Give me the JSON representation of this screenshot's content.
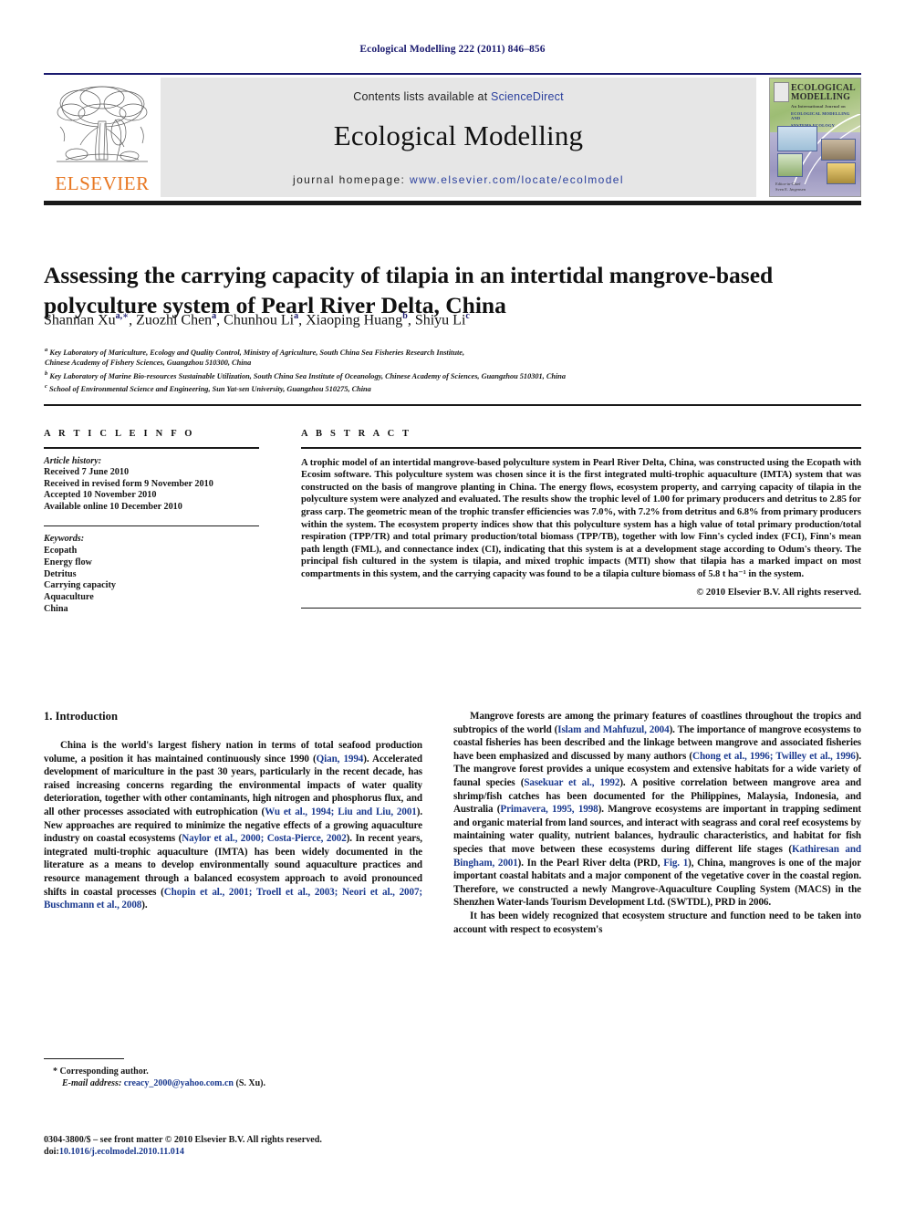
{
  "running_head": "Ecological Modelling 222 (2011) 846–856",
  "masthead": {
    "contents_prefix": "Contents lists available at ",
    "sciencedirect": "ScienceDirect",
    "journal_title": "Ecological Modelling",
    "homepage_label": "journal homepage: ",
    "homepage_url": "www.elsevier.com/locate/ecolmodel",
    "publisher_wordmark": "ELSEVIER",
    "publisher_logo_icon": "elsevier-tree-icon",
    "cover": {
      "line1": "ECOLOGICAL",
      "line2": "MODELLING",
      "subtitle": "An International Journal on",
      "scope": "ECOLOGICAL MODELLING AND",
      "scope2": "SYSTEMS ECOLOGY",
      "editor_label": "Editor-in-Chief",
      "editor": "Sven E. Jørgensen"
    },
    "accent_blue": "#1b1b6f",
    "banner_bg": "#e6e6e6",
    "link_blue": "#2a3f9d",
    "elsevier_orange": "#e87722"
  },
  "article": {
    "title": "Assessing the carrying capacity of tilapia in an intertidal mangrove-based polyculture system of Pearl River Delta, China",
    "authors_html": "Shannan Xu<sup>a,∗</sup>, Zuozhi Chen<sup>a</sup>, Chunhou Li<sup>a</sup>, Xiaoping Huang<sup>b</sup>, Shiyu Li<sup>c</sup>",
    "affiliations": [
      "<sup>a</sup> Key Laboratory of Mariculture, Ecology and Quality Control, Ministry of Agriculture, South China Sea Fisheries Research Institute,",
      "Chinese Academy of Fishery Sciences, Guangzhou 510300, China",
      "<sup>b</sup> Key Laboratory of Marine Bio-resources Sustainable Utilization, South China Sea Institute of Oceanology, Chinese Academy of Sciences, Guangzhou 510301, China",
      "<sup>c</sup> School of Environmental Science and Engineering, Sun Yat-sen University, Guangzhou 510275, China"
    ]
  },
  "article_info": {
    "heading": "A R T I C L E   I N F O",
    "history_label": "Article history:",
    "history": [
      "Received 7 June 2010",
      "Received in revised form 9 November 2010",
      "Accepted 10 November 2010",
      "Available online 10 December 2010"
    ],
    "keywords_label": "Keywords:",
    "keywords": [
      "Ecopath",
      "Energy flow",
      "Detritus",
      "Carrying capacity",
      "Aquaculture",
      "China"
    ]
  },
  "abstract": {
    "heading": "A B S T R A C T",
    "text": "A trophic model of an intertidal mangrove-based polyculture system in Pearl River Delta, China, was constructed using the Ecopath with Ecosim software. This polyculture system was chosen since it is the first integrated multi-trophic aquaculture (IMTA) system that was constructed on the basis of mangrove planting in China. The energy flows, ecosystem property, and carrying capacity of tilapia in the polyculture system were analyzed and evaluated. The results show the trophic level of 1.00 for primary producers and detritus to 2.85 for grass carp. The geometric mean of the trophic transfer efficiencies was 7.0%, with 7.2% from detritus and 6.8% from primary producers within the system. The ecosystem property indices show that this polyculture system has a high value of total primary production/total respiration (TPP/TR) and total primary production/total biomass (TPP/TB), together with low Finn's cycled index (FCI), Finn's mean path length (FML), and connectance index (CI), indicating that this system is at a development stage according to Odum's theory. The principal fish cultured in the system is tilapia, and mixed trophic impacts (MTI) show that tilapia has a marked impact on most compartments in this system, and the carrying capacity was found to be a tilapia culture biomass of 5.8 t ha⁻¹ in the system.",
    "copyright": "© 2010 Elsevier B.V. All rights reserved."
  },
  "body": {
    "section_heading": "1.  Introduction",
    "left_paragraphs": [
      "China is the world's largest fishery nation in terms of total seafood production volume, a position it has maintained continuously since 1990 (<span class=\"ref\">Qian, 1994</span>). Accelerated development of mariculture in the past 30 years, particularly in the recent decade, has raised increasing concerns regarding the environmental impacts of water quality deterioration, together with other contaminants, high nitrogen and phosphorus flux, and all other processes associated with eutrophication (<span class=\"ref\">Wu et al., 1994; Liu and Liu, 2001</span>). New approaches are required to minimize the negative effects of a growing aquaculture industry on coastal ecosystems (<span class=\"ref\">Naylor et al., 2000; Costa-Pierce, 2002</span>). In recent years, integrated multi-trophic aquaculture (IMTA) has been widely documented in the literature as a means to develop environmentally sound aquaculture practices and resource management through a balanced ecosystem approach to avoid pronounced shifts in coastal processes (<span class=\"ref\">Chopin et al., 2001; Troell et al., 2003; Neori et al., 2007; Buschmann et al., 2008</span>)."
    ],
    "right_paragraphs": [
      "Mangrove forests are among the primary features of coastlines throughout the tropics and subtropics of the world (<span class=\"ref\">Islam and Mahfuzul, 2004</span>). The importance of mangrove ecosystems to coastal fisheries has been described and the linkage between mangrove and associated fisheries have been emphasized and discussed by many authors (<span class=\"ref\">Chong et al., 1996; Twilley et al., 1996</span>). The mangrove forest provides a unique ecosystem and extensive habitats for a wide variety of faunal species (<span class=\"ref\">Sasekuar et al., 1992</span>). A positive correlation between mangrove area and shrimp/fish catches has been documented for the Philippines, Malaysia, Indonesia, and Australia (<span class=\"ref\">Primavera, 1995, 1998</span>). Mangrove ecosystems are important in trapping sediment and organic material from land sources, and interact with seagrass and coral reef ecosystems by maintaining water quality, nutrient balances, hydraulic characteristics, and habitat for fish species that move between these ecosystems during different life stages (<span class=\"ref\">Kathiresan and Bingham, 2001</span>). In the Pearl River delta (PRD, <span class=\"ref\">Fig. 1</span>), China, mangroves is one of the major important coastal habitats and a major component of the vegetative cover in the coastal region. Therefore, we constructed a newly Mangrove-Aquaculture Coupling System (MACS) in the Shenzhen Water-lands Tourism Development Ltd. (SWTDL), PRD in 2006.",
      "It has been widely recognized that ecosystem structure and function need to be taken into account with respect to ecosystem's"
    ]
  },
  "footer": {
    "corresponding_marker": "*",
    "corresponding_label": "Corresponding author.",
    "email_label": "E-mail address:",
    "email": "creacy_2000@yahoo.com.cn",
    "email_attrib": "(S. Xu).",
    "issn_line": "0304-3800/$ – see front matter © 2010 Elsevier B.V. All rights reserved.",
    "doi_label": "doi:",
    "doi": "10.1016/j.ecolmodel.2010.11.014"
  }
}
